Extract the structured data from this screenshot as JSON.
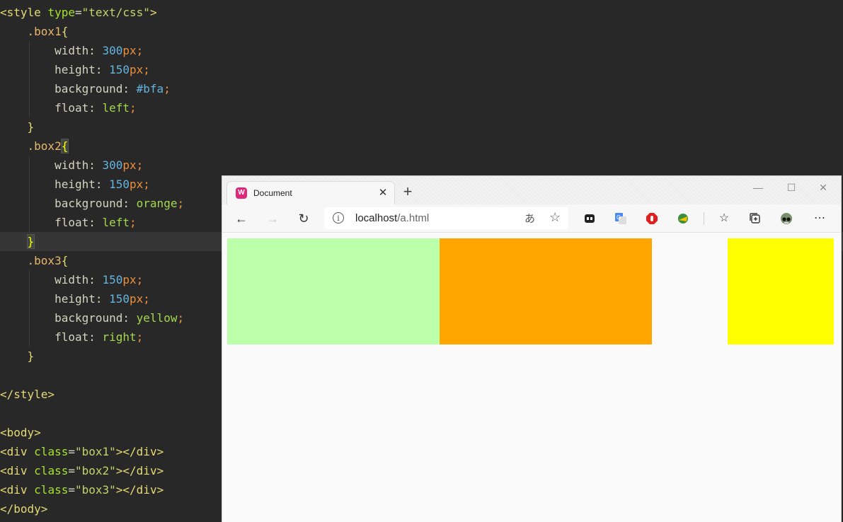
{
  "editor": {
    "lines": [
      [
        [
          "tag",
          "<style "
        ],
        [
          "attr",
          "type"
        ],
        [
          "punc",
          "="
        ],
        [
          "str",
          "\"text/css\""
        ],
        [
          "tag",
          ">"
        ]
      ],
      [
        [
          "punc",
          "    "
        ],
        [
          "sel",
          ".box1"
        ],
        [
          "brace",
          "{"
        ]
      ],
      [
        [
          "punc",
          "        "
        ],
        [
          "prop",
          "width"
        ],
        [
          "punc",
          ": "
        ],
        [
          "num",
          "300"
        ],
        [
          "unit",
          "px"
        ],
        [
          "semi",
          ";"
        ]
      ],
      [
        [
          "punc",
          "        "
        ],
        [
          "prop",
          "height"
        ],
        [
          "punc",
          ": "
        ],
        [
          "num",
          "150"
        ],
        [
          "unit",
          "px"
        ],
        [
          "semi",
          ";"
        ]
      ],
      [
        [
          "punc",
          "        "
        ],
        [
          "prop",
          "background"
        ],
        [
          "punc",
          ": "
        ],
        [
          "hex",
          "#bfa"
        ],
        [
          "semi",
          ";"
        ]
      ],
      [
        [
          "punc",
          "        "
        ],
        [
          "prop",
          "float"
        ],
        [
          "punc",
          ": "
        ],
        [
          "kw",
          "left"
        ],
        [
          "semi",
          ";"
        ]
      ],
      [
        [
          "punc",
          "    "
        ],
        [
          "brace",
          "}"
        ]
      ],
      [
        [
          "punc",
          "    "
        ],
        [
          "sel",
          ".box2"
        ],
        [
          "bracem",
          "{"
        ]
      ],
      [
        [
          "punc",
          "        "
        ],
        [
          "prop",
          "width"
        ],
        [
          "punc",
          ": "
        ],
        [
          "num",
          "300"
        ],
        [
          "unit",
          "px"
        ],
        [
          "semi",
          ";"
        ]
      ],
      [
        [
          "punc",
          "        "
        ],
        [
          "prop",
          "height"
        ],
        [
          "punc",
          ": "
        ],
        [
          "num",
          "150"
        ],
        [
          "unit",
          "px"
        ],
        [
          "semi",
          ";"
        ]
      ],
      [
        [
          "punc",
          "        "
        ],
        [
          "prop",
          "background"
        ],
        [
          "punc",
          ": "
        ],
        [
          "kw",
          "orange"
        ],
        [
          "semi",
          ";"
        ]
      ],
      [
        [
          "punc",
          "        "
        ],
        [
          "prop",
          "float"
        ],
        [
          "punc",
          ": "
        ],
        [
          "kw",
          "left"
        ],
        [
          "semi",
          ";"
        ]
      ],
      [
        [
          "punc",
          "    "
        ],
        [
          "bracem",
          "}"
        ]
      ],
      [
        [
          "punc",
          "    "
        ],
        [
          "sel",
          ".box3"
        ],
        [
          "brace",
          "{"
        ]
      ],
      [
        [
          "punc",
          "        "
        ],
        [
          "prop",
          "width"
        ],
        [
          "punc",
          ": "
        ],
        [
          "num",
          "150"
        ],
        [
          "unit",
          "px"
        ],
        [
          "semi",
          ";"
        ]
      ],
      [
        [
          "punc",
          "        "
        ],
        [
          "prop",
          "height"
        ],
        [
          "punc",
          ": "
        ],
        [
          "num",
          "150"
        ],
        [
          "unit",
          "px"
        ],
        [
          "semi",
          ";"
        ]
      ],
      [
        [
          "punc",
          "        "
        ],
        [
          "prop",
          "background"
        ],
        [
          "punc",
          ": "
        ],
        [
          "kw",
          "yellow"
        ],
        [
          "semi",
          ";"
        ]
      ],
      [
        [
          "punc",
          "        "
        ],
        [
          "prop",
          "float"
        ],
        [
          "punc",
          ": "
        ],
        [
          "kw",
          "right"
        ],
        [
          "semi",
          ";"
        ]
      ],
      [
        [
          "punc",
          "    "
        ],
        [
          "brace",
          "}"
        ]
      ],
      [],
      [
        [
          "tag",
          "</style>"
        ]
      ],
      [],
      [
        [
          "tag",
          "<body>"
        ]
      ],
      [
        [
          "tag",
          "<div "
        ],
        [
          "attr",
          "class"
        ],
        [
          "punc",
          "="
        ],
        [
          "str",
          "\"box1\""
        ],
        [
          "tag",
          "></div>"
        ]
      ],
      [
        [
          "tag",
          "<div "
        ],
        [
          "attr",
          "class"
        ],
        [
          "punc",
          "="
        ],
        [
          "str",
          "\"box2\""
        ],
        [
          "tag",
          "></div>"
        ]
      ],
      [
        [
          "tag",
          "<div "
        ],
        [
          "attr",
          "class"
        ],
        [
          "punc",
          "="
        ],
        [
          "str",
          "\"box3\""
        ],
        [
          "tag",
          "></div>"
        ]
      ],
      [
        [
          "tag",
          "</body>"
        ]
      ]
    ]
  },
  "browser": {
    "tab_title": "Document",
    "favicon_letter": "W",
    "url_host": "localhost",
    "url_path": "/a.html",
    "boxes": [
      {
        "name": "box1",
        "color": "#bbffaa"
      },
      {
        "name": "box2",
        "color": "#ffa500"
      },
      {
        "name": "box3",
        "color": "#ffff00"
      }
    ]
  }
}
